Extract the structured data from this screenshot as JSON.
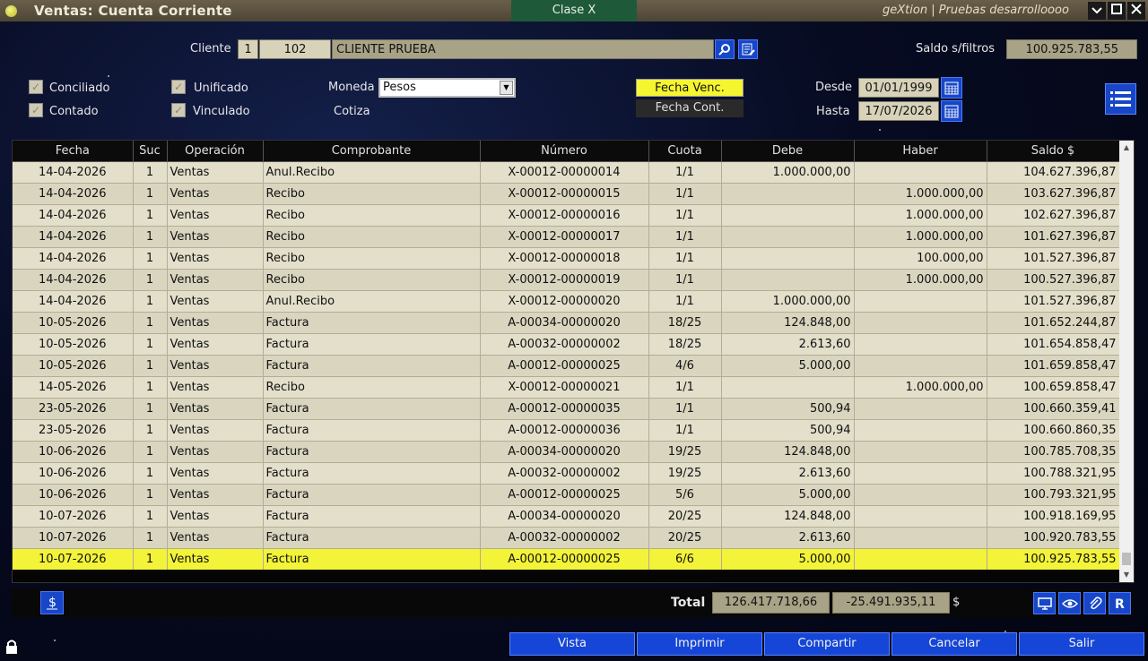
{
  "window": {
    "title": "Ventas: Cuenta Corriente",
    "tab": "Clase X",
    "app_info": "geXtion | Pruebas desarrolloooo"
  },
  "header": {
    "cliente_label": "Cliente",
    "cliente_suc": "1",
    "cliente_code": "102",
    "cliente_name": "CLIENTE PRUEBA",
    "saldo_label": "Saldo s/filtros",
    "saldo_value": "100.925.783,55"
  },
  "filters": {
    "conciliado": "Conciliado",
    "contado": "Contado",
    "unificado": "Unificado",
    "vinculado": "Vinculado",
    "moneda_label": "Moneda",
    "moneda_value": "Pesos",
    "cotiza_label": "Cotiza",
    "fecha_venc": "Fecha Venc.",
    "fecha_cont": "Fecha Cont.",
    "desde_label": "Desde",
    "desde_value": "01/01/1999",
    "hasta_label": "Hasta",
    "hasta_value": "17/07/2026"
  },
  "table": {
    "columns": [
      "Fecha",
      "Suc",
      "Operación",
      "Comprobante",
      "Número",
      "Cuota",
      "Debe",
      "Haber",
      "Saldo $"
    ],
    "rows": [
      [
        "14-04-2026",
        "1",
        "Ventas",
        "Anul.Recibo",
        "X-00012-00000014",
        "1/1",
        "1.000.000,00",
        "",
        "104.627.396,87"
      ],
      [
        "14-04-2026",
        "1",
        "Ventas",
        "Recibo",
        "X-00012-00000015",
        "1/1",
        "",
        "1.000.000,00",
        "103.627.396,87"
      ],
      [
        "14-04-2026",
        "1",
        "Ventas",
        "Recibo",
        "X-00012-00000016",
        "1/1",
        "",
        "1.000.000,00",
        "102.627.396,87"
      ],
      [
        "14-04-2026",
        "1",
        "Ventas",
        "Recibo",
        "X-00012-00000017",
        "1/1",
        "",
        "1.000.000,00",
        "101.627.396,87"
      ],
      [
        "14-04-2026",
        "1",
        "Ventas",
        "Recibo",
        "X-00012-00000018",
        "1/1",
        "",
        "100.000,00",
        "101.527.396,87"
      ],
      [
        "14-04-2026",
        "1",
        "Ventas",
        "Recibo",
        "X-00012-00000019",
        "1/1",
        "",
        "1.000.000,00",
        "100.527.396,87"
      ],
      [
        "14-04-2026",
        "1",
        "Ventas",
        "Anul.Recibo",
        "X-00012-00000020",
        "1/1",
        "1.000.000,00",
        "",
        "101.527.396,87"
      ],
      [
        "10-05-2026",
        "1",
        "Ventas",
        "Factura",
        "A-00034-00000020",
        "18/25",
        "124.848,00",
        "",
        "101.652.244,87"
      ],
      [
        "10-05-2026",
        "1",
        "Ventas",
        "Factura",
        "A-00032-00000002",
        "18/25",
        "2.613,60",
        "",
        "101.654.858,47"
      ],
      [
        "10-05-2026",
        "1",
        "Ventas",
        "Factura",
        "A-00012-00000025",
        "4/6",
        "5.000,00",
        "",
        "101.659.858,47"
      ],
      [
        "14-05-2026",
        "1",
        "Ventas",
        "Recibo",
        "X-00012-00000021",
        "1/1",
        "",
        "1.000.000,00",
        "100.659.858,47"
      ],
      [
        "23-05-2026",
        "1",
        "Ventas",
        "Factura",
        "A-00012-00000035",
        "1/1",
        "500,94",
        "",
        "100.660.359,41"
      ],
      [
        "23-05-2026",
        "1",
        "Ventas",
        "Factura",
        "A-00012-00000036",
        "1/1",
        "500,94",
        "",
        "100.660.860,35"
      ],
      [
        "10-06-2026",
        "1",
        "Ventas",
        "Factura",
        "A-00034-00000020",
        "19/25",
        "124.848,00",
        "",
        "100.785.708,35"
      ],
      [
        "10-06-2026",
        "1",
        "Ventas",
        "Factura",
        "A-00032-00000002",
        "19/25",
        "2.613,60",
        "",
        "100.788.321,95"
      ],
      [
        "10-06-2026",
        "1",
        "Ventas",
        "Factura",
        "A-00012-00000025",
        "5/6",
        "5.000,00",
        "",
        "100.793.321,95"
      ],
      [
        "10-07-2026",
        "1",
        "Ventas",
        "Factura",
        "A-00034-00000020",
        "20/25",
        "124.848,00",
        "",
        "100.918.169,95"
      ],
      [
        "10-07-2026",
        "1",
        "Ventas",
        "Factura",
        "A-00032-00000002",
        "20/25",
        "2.613,60",
        "",
        "100.920.783,55"
      ],
      [
        "10-07-2026",
        "1",
        "Ventas",
        "Factura",
        "A-00012-00000025",
        "6/6",
        "5.000,00",
        "",
        "100.925.783,55"
      ]
    ],
    "selected_row": 18
  },
  "totals": {
    "label": "Total",
    "debe": "126.417.718,66",
    "diff": "-25.491.935,11",
    "currency": "$"
  },
  "buttons": {
    "vista": "Vista",
    "imprimir": "Imprimir",
    "compartir": "Compartir",
    "cancelar": "Cancelar",
    "salir": "Salir"
  },
  "icons": [
    "search-icon",
    "edit-icon",
    "calendar-icon",
    "list-icon",
    "dollar-icon",
    "monitor-icon",
    "eye-icon",
    "paperclip-icon",
    "r-icon",
    "lock-icon"
  ],
  "colors": {
    "accent_blue": "#1747c8",
    "selected_row": "#f3f339",
    "row_bg": "#e3dfca",
    "title_bar": "#5a5140"
  }
}
